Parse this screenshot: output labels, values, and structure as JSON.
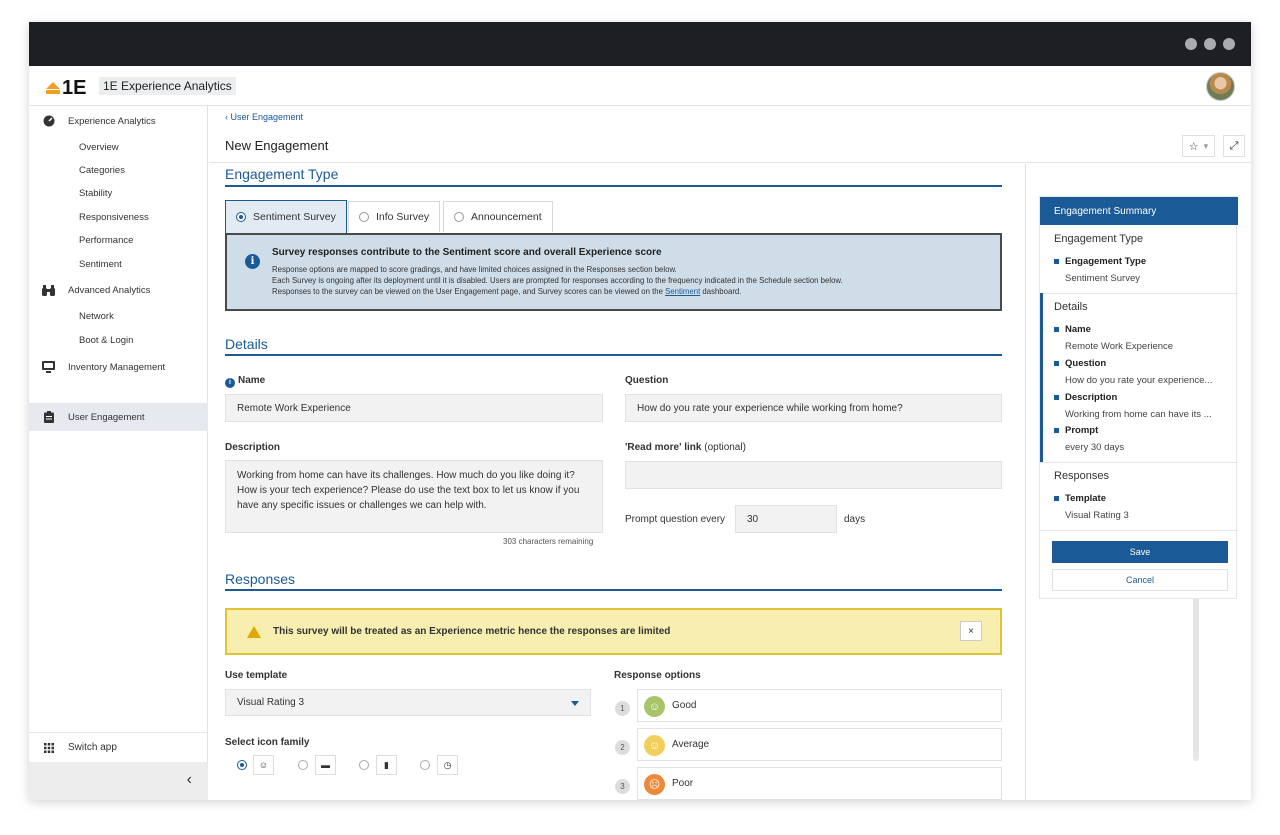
{
  "app": {
    "name": "1E Experience Analytics"
  },
  "sidebar": {
    "groups": [
      {
        "label": "Experience Analytics",
        "icon": "gauge-icon",
        "items": [
          "Overview",
          "Categories",
          "Stability",
          "Responsiveness",
          "Performance",
          "Sentiment"
        ]
      },
      {
        "label": "Advanced Analytics",
        "icon": "binoculars-icon",
        "items": [
          "Network",
          "Boot & Login"
        ]
      },
      {
        "label": "Inventory Management",
        "icon": "monitor-icon",
        "items": []
      },
      {
        "label": "User Engagement",
        "icon": "clipboard-icon",
        "items": []
      }
    ],
    "switch_app": "Switch app",
    "collapse": "‹"
  },
  "breadcrumb": "User Engagement",
  "page_title": "New Engagement",
  "header_buttons": {
    "star": "☆",
    "dropdown": "▾",
    "expand": "⤢"
  },
  "engagement_type": {
    "title": "Engagement Type",
    "tabs": [
      "Sentiment Survey",
      "Info Survey",
      "Announcement"
    ],
    "info": {
      "title": "Survey responses contribute to the Sentiment score and overall Experience score",
      "line1": "Response options are mapped to score gradings, and have limited choices assigned in the Responses section below.",
      "line2": "Each Survey is ongoing after its deployment until it is disabled. Users are prompted for responses according to the frequency indicated in the Schedule section below.",
      "line3_pre": "Responses to the survey can be viewed on the User Engagement page, and Survey scores can be viewed on the ",
      "line3_link": "Sentiment",
      "line3_post": " dashboard."
    }
  },
  "details": {
    "title": "Details",
    "name_label": "Name",
    "name_value": "Remote Work Experience",
    "question_label": "Question",
    "question_value": "How do you rate your experience while working from home?",
    "description_label": "Description",
    "description_value": "Working from home can have its challenges. How much do you like doing it? How is your tech experience? Please do use the text box to let us know if you have any specific issues or challenges we can help with.",
    "chars_remaining": "303 characters remaining",
    "read_more_label": "'Read more' link",
    "read_more_optional": "(optional)",
    "read_more_value": "",
    "prompt_label": "Prompt question every",
    "prompt_value": "30",
    "prompt_unit": "days"
  },
  "responses": {
    "title": "Responses",
    "warning": "This survey will be treated as an Experience metric hence the responses are limited",
    "warning_close": "×",
    "template_label": "Use template",
    "template_value": "Visual Rating 3",
    "icon_family_label": "Select icon family",
    "icon_families": [
      "☺",
      "▬",
      "▮",
      "◷"
    ],
    "options_label": "Response options",
    "options": [
      {
        "num": "1",
        "label": "Good",
        "color": "#a8c46a",
        "face": "☺"
      },
      {
        "num": "2",
        "label": "Average",
        "color": "#f2cf5b",
        "face": "☺"
      },
      {
        "num": "3",
        "label": "Poor",
        "color": "#ec8a3c",
        "face": "☹"
      }
    ]
  },
  "summary": {
    "title": "Engagement Summary",
    "type_section": "Engagement Type",
    "type_key": "Engagement Type",
    "type_val": "Sentiment Survey",
    "details_section": "Details",
    "name_key": "Name",
    "name_val": "Remote Work Experience",
    "question_key": "Question",
    "question_val": "How do you rate your experience...",
    "description_key": "Description",
    "description_val": "Working from home can have its ...",
    "prompt_key": "Prompt",
    "prompt_val": "every 30 days",
    "responses_section": "Responses",
    "template_key": "Template",
    "template_val": "Visual Rating 3",
    "save": "Save",
    "cancel": "Cancel"
  },
  "colors": {
    "accent": "#1a5a96",
    "warning_bg": "#f7eeb0",
    "info_bg": "#cfdde8"
  }
}
